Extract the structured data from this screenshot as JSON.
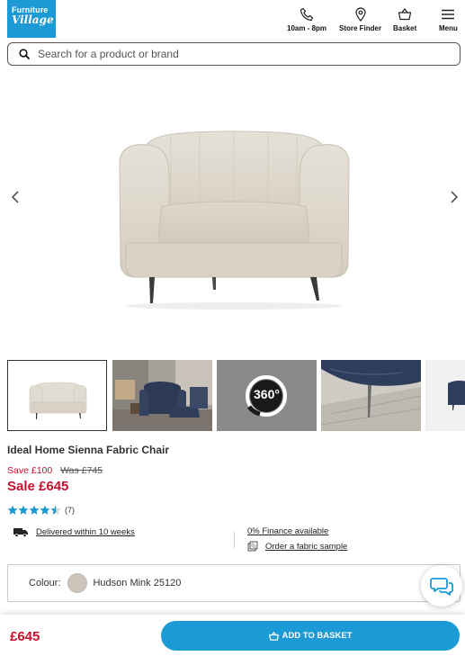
{
  "header": {
    "logo_line1": "Furniture",
    "logo_line2": "Village",
    "nav": [
      {
        "label": "10am - 8pm",
        "icon": "phone-icon"
      },
      {
        "label": "Store Finder",
        "icon": "location-pin-icon"
      },
      {
        "label": "Basket",
        "icon": "basket-icon"
      },
      {
        "label": "Menu",
        "icon": "hamburger-menu-icon"
      }
    ]
  },
  "search": {
    "placeholder": "Search for a product or brand"
  },
  "gallery": {
    "thumbnails": [
      {
        "name": "chair-front-view",
        "active": true
      },
      {
        "name": "room-lifestyle-view",
        "active": false
      },
      {
        "name": "360-view",
        "label": "360°",
        "active": false
      },
      {
        "name": "leg-closeup-view",
        "active": false
      },
      {
        "name": "side-closeup-view",
        "active": false
      }
    ]
  },
  "product": {
    "title": "Ideal Home Sienna Fabric Chair",
    "save_text": "Save £100",
    "was_text": "Was £745",
    "sale_text": "Sale £645",
    "rating": 4.5,
    "review_count": "(7)",
    "delivery_text": "Delivered within 10 weeks",
    "finance_text": "0% Finance available",
    "sample_text": "Order a fabric sample",
    "colour_label": "Colour:",
    "colour_value": "Hudson Mink 25120"
  },
  "bottom_bar": {
    "price": "£645",
    "add_to_basket": "ADD TO BASKET"
  },
  "colors": {
    "brand_blue": "#1b9ad6",
    "sale_red": "#c8102e",
    "star_blue": "#1b9ad6"
  }
}
